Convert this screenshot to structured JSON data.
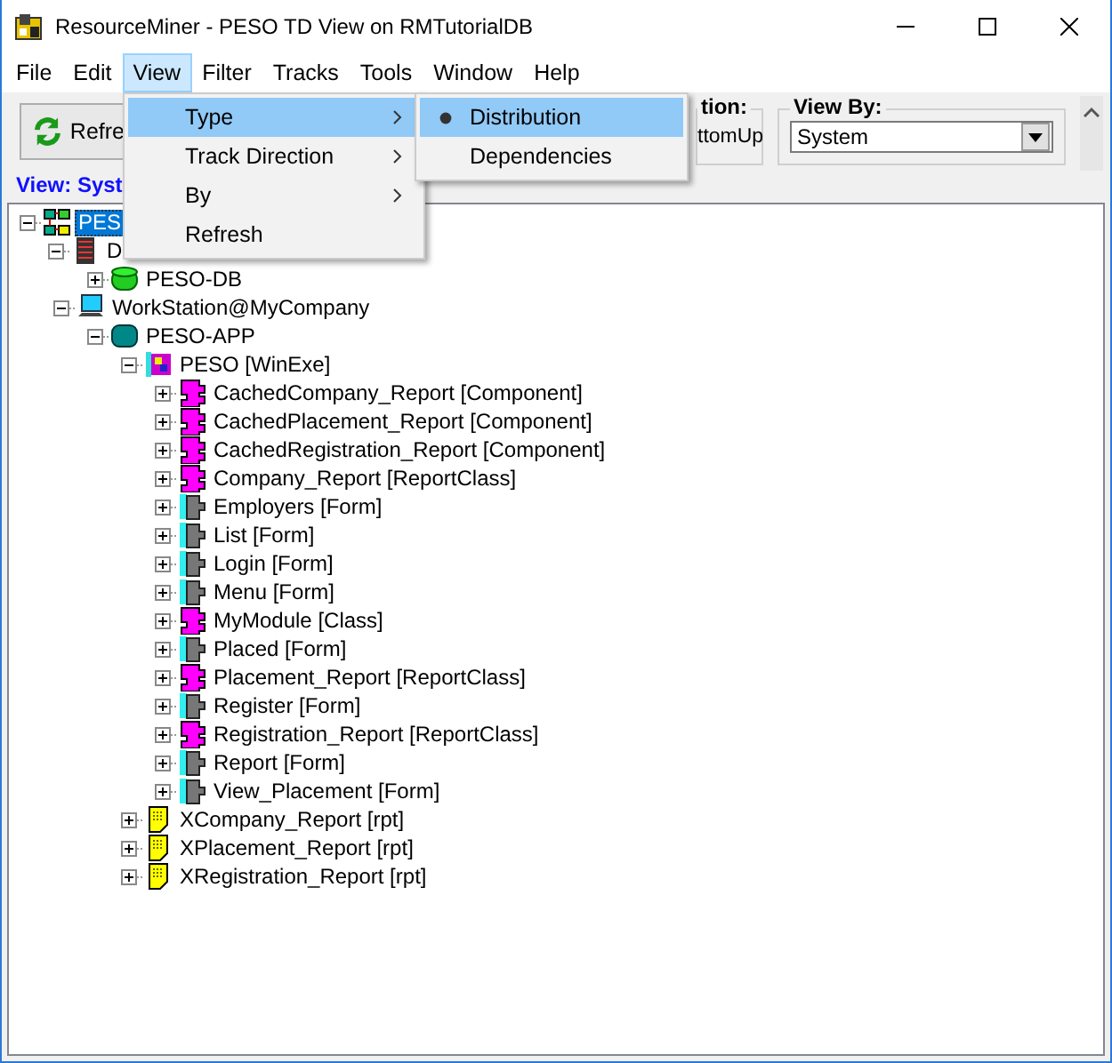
{
  "window": {
    "title": "ResourceMiner - PESO TD View on RMTutorialDB"
  },
  "menu_bar": [
    {
      "label": "File",
      "selected": false
    },
    {
      "label": "Edit",
      "selected": false
    },
    {
      "label": "View",
      "selected": true
    },
    {
      "label": "Filter",
      "selected": false
    },
    {
      "label": "Tracks",
      "selected": false
    },
    {
      "label": "Tools",
      "selected": false
    },
    {
      "label": "Window",
      "selected": false
    },
    {
      "label": "Help",
      "selected": false
    }
  ],
  "toolbar": {
    "refresh_button": "Refre",
    "direction_group": {
      "label": "tion:",
      "option": "ttomUp"
    },
    "view_by": {
      "label": "View By:",
      "value": "System"
    }
  },
  "view_label": "View: Syst",
  "open_menu": [
    {
      "label": "Type",
      "selected": true,
      "submenu": true
    },
    {
      "label": "Track Direction",
      "selected": false,
      "submenu": true
    },
    {
      "label": "By",
      "selected": false,
      "submenu": true
    },
    {
      "label": "Refresh",
      "selected": false,
      "submenu": false
    }
  ],
  "submenu": [
    {
      "label": "Distribution",
      "selected": true,
      "checked": true
    },
    {
      "label": "Dependencies",
      "selected": false,
      "checked": false
    }
  ],
  "tree": [
    {
      "label": "PES",
      "kind": "system",
      "expanded": true,
      "selected": true,
      "children": [
        {
          "label": "D",
          "kind": "server",
          "expanded": true,
          "selected": false,
          "children": [
            {
              "label": "PESO-DB",
              "kind": "database",
              "expanded": false,
              "selected": false
            }
          ]
        },
        {
          "label": "WorkStation@MyCompany",
          "kind": "workstation",
          "expanded": true,
          "selected": false,
          "children": [
            {
              "label": "PESO-APP",
              "kind": "appserver",
              "expanded": true,
              "selected": false,
              "children": [
                {
                  "label": "PESO [WinExe]",
                  "kind": "exe",
                  "expanded": true,
                  "selected": false,
                  "children": [
                    {
                      "label": "CachedCompany_Report [Component]",
                      "kind": "component",
                      "expanded": false,
                      "selected": false
                    },
                    {
                      "label": "CachedPlacement_Report [Component]",
                      "kind": "component",
                      "expanded": false,
                      "selected": false
                    },
                    {
                      "label": "CachedRegistration_Report [Component]",
                      "kind": "component",
                      "expanded": false,
                      "selected": false
                    },
                    {
                      "label": "Company_Report [ReportClass]",
                      "kind": "component",
                      "expanded": false,
                      "selected": false
                    },
                    {
                      "label": "Employers [Form]",
                      "kind": "form",
                      "expanded": false,
                      "selected": false
                    },
                    {
                      "label": "List [Form]",
                      "kind": "form",
                      "expanded": false,
                      "selected": false
                    },
                    {
                      "label": "Login [Form]",
                      "kind": "form",
                      "expanded": false,
                      "selected": false
                    },
                    {
                      "label": "Menu [Form]",
                      "kind": "form",
                      "expanded": false,
                      "selected": false
                    },
                    {
                      "label": "MyModule [Class]",
                      "kind": "component",
                      "expanded": false,
                      "selected": false
                    },
                    {
                      "label": "Placed [Form]",
                      "kind": "form",
                      "expanded": false,
                      "selected": false
                    },
                    {
                      "label": "Placement_Report [ReportClass]",
                      "kind": "component",
                      "expanded": false,
                      "selected": false
                    },
                    {
                      "label": "Register [Form]",
                      "kind": "form",
                      "expanded": false,
                      "selected": false
                    },
                    {
                      "label": "Registration_Report [ReportClass]",
                      "kind": "component",
                      "expanded": false,
                      "selected": false
                    },
                    {
                      "label": "Report [Form]",
                      "kind": "form",
                      "expanded": false,
                      "selected": false
                    },
                    {
                      "label": "View_Placement [Form]",
                      "kind": "form",
                      "expanded": false,
                      "selected": false
                    }
                  ]
                },
                {
                  "label": "XCompany_Report [rpt]",
                  "kind": "report",
                  "expanded": false,
                  "selected": false
                },
                {
                  "label": "XPlacement_Report [rpt]",
                  "kind": "report",
                  "expanded": false,
                  "selected": false
                },
                {
                  "label": "XRegistration_Report [rpt]",
                  "kind": "report",
                  "expanded": false,
                  "selected": false
                }
              ]
            }
          ]
        }
      ]
    }
  ]
}
